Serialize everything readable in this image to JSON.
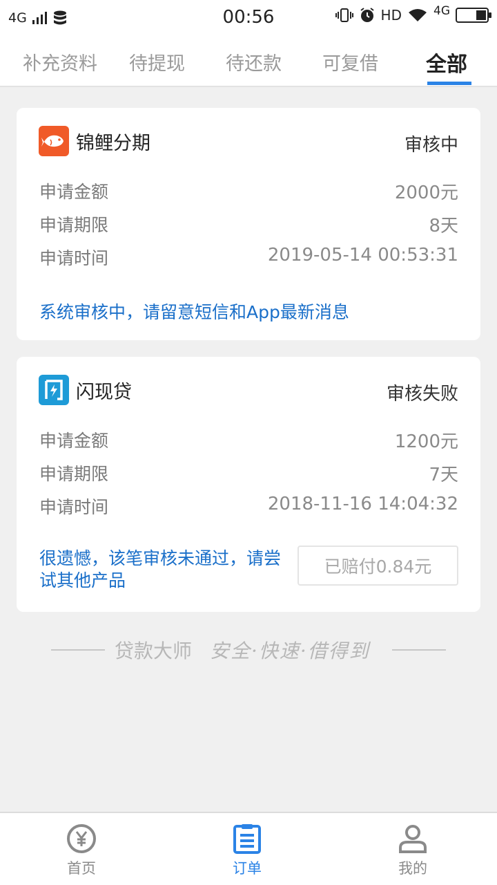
{
  "status_bar": {
    "network_left": "4G",
    "time": "00:56",
    "hd": "HD",
    "network_right": "4G"
  },
  "tabs": [
    {
      "label": "补充资料",
      "active": false
    },
    {
      "label": "待提现",
      "active": false
    },
    {
      "label": "待还款",
      "active": false
    },
    {
      "label": "可复借",
      "active": false
    },
    {
      "label": "全部",
      "active": true
    }
  ],
  "orders": [
    {
      "name": "锦鲤分期",
      "status": "审核中",
      "logo_color": "#f05a28",
      "rows": [
        {
          "label": "申请金额",
          "value": "2000元"
        },
        {
          "label": "申请期限",
          "value": "8天"
        },
        {
          "label": "申请时间",
          "value": "2019-05-14 00:53:31"
        }
      ],
      "note": "系统审核中，请留意短信和App最新消息"
    },
    {
      "name": "闪现贷",
      "status": "审核失败",
      "logo_color": "#1e9bd7",
      "rows": [
        {
          "label": "申请金额",
          "value": "1200元"
        },
        {
          "label": "申请期限",
          "value": "7天"
        },
        {
          "label": "申请时间",
          "value": "2018-11-16 14:04:32"
        }
      ],
      "note": "很遗憾，该笔审核未通过，请尝试其他产品",
      "button": "已赔付0.84元"
    }
  ],
  "slogan": {
    "brand": "贷款大师",
    "text": "安全·快速·借得到"
  },
  "bottom_nav": [
    {
      "label": "首页",
      "icon": "yen-circle-icon",
      "active": false
    },
    {
      "label": "订单",
      "icon": "order-list-icon",
      "active": true
    },
    {
      "label": "我的",
      "icon": "user-icon",
      "active": false
    }
  ],
  "colors": {
    "accent": "#2b83e6",
    "note_blue": "#1a6fc9",
    "background": "#f0f0f0"
  }
}
